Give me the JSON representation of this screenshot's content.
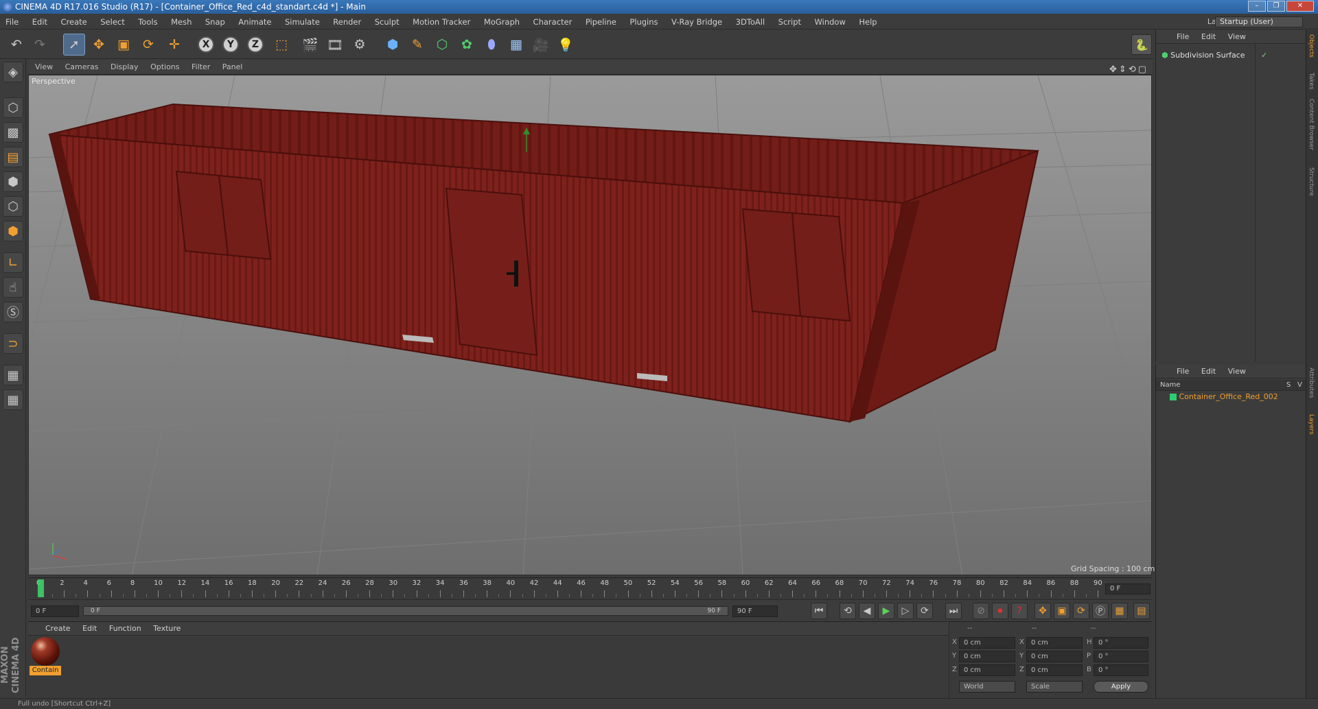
{
  "window": {
    "title": "CINEMA 4D R17.016 Studio (R17) - [Container_Office_Red_c4d_standart.c4d *] - Main",
    "buttons": [
      "–",
      "❐",
      "✕"
    ]
  },
  "menubar": {
    "items": [
      "File",
      "Edit",
      "Create",
      "Select",
      "Tools",
      "Mesh",
      "Snap",
      "Animate",
      "Simulate",
      "Render",
      "Sculpt",
      "Motion Tracker",
      "MoGraph",
      "Character",
      "Pipeline",
      "Plugins",
      "V-Ray Bridge",
      "3DToAll",
      "Script",
      "Window",
      "Help"
    ],
    "layout_label": "Layout:",
    "layout_value": "Startup (User)"
  },
  "toolbar": {
    "icons": [
      "undo-icon",
      "redo-icon",
      "select-arrow-icon",
      "move-icon",
      "scale-icon",
      "rotate-icon",
      "live-select-icon",
      "x-axis-icon",
      "y-axis-icon",
      "z-axis-icon",
      "coordinate-system-icon",
      "render-view-icon",
      "render-picture-viewer-icon",
      "render-settings-icon",
      "cube-icon",
      "pen-icon",
      "subdivision-icon",
      "array-icon",
      "deformer-icon",
      "floor-icon",
      "camera-icon",
      "light-icon"
    ],
    "axis_x": "X",
    "axis_y": "Y",
    "axis_z": "Z"
  },
  "viewport": {
    "menu": [
      "View",
      "Cameras",
      "Display",
      "Options",
      "Filter",
      "Panel"
    ],
    "label": "Perspective",
    "grid_spacing": "Grid Spacing : 100 cm",
    "nav_glyphs": "✥⇕⟲▢"
  },
  "timeline": {
    "ticks": [
      "0",
      "2",
      "4",
      "6",
      "8",
      "10",
      "12",
      "14",
      "16",
      "18",
      "20",
      "22",
      "24",
      "26",
      "28",
      "30",
      "32",
      "34",
      "36",
      "38",
      "40",
      "42",
      "44",
      "46",
      "48",
      "50",
      "52",
      "54",
      "56",
      "58",
      "60",
      "62",
      "64",
      "66",
      "68",
      "70",
      "72",
      "74",
      "76",
      "78",
      "80",
      "82",
      "84",
      "86",
      "88",
      "90"
    ],
    "current_frame": "0 F",
    "end_frame_field": "0 F"
  },
  "transport": {
    "start_field": "0 F",
    "range_start": "0 F",
    "range_end": "90 F",
    "end_field": "90 F"
  },
  "materials": {
    "menu": [
      "Create",
      "Edit",
      "Function",
      "Texture"
    ],
    "items": [
      {
        "label": "Contain"
      }
    ]
  },
  "coordinates": {
    "headers": [
      "--",
      "--",
      "--"
    ],
    "rows": [
      {
        "axis": "X",
        "pos": "0 cm",
        "saxis": "X",
        "size": "0 cm",
        "raxis": "H",
        "rot": "0 °"
      },
      {
        "axis": "Y",
        "pos": "0 cm",
        "saxis": "Y",
        "size": "0 cm",
        "raxis": "P",
        "rot": "0 °"
      },
      {
        "axis": "Z",
        "pos": "0 cm",
        "saxis": "Z",
        "size": "0 cm",
        "raxis": "B",
        "rot": "0 °"
      }
    ],
    "mode1": "World",
    "mode2": "Scale",
    "apply": "Apply"
  },
  "objects_panel": {
    "menu": [
      "File",
      "Edit",
      "View"
    ],
    "items": [
      {
        "name": "Subdivision Surface"
      }
    ]
  },
  "layers_panel": {
    "menu": [
      "File",
      "Edit",
      "View"
    ],
    "header_name": "Name",
    "header_s": "S",
    "header_v": "V",
    "items": [
      {
        "name": "Container_Office_Red_002",
        "color": "#2ecc71"
      }
    ]
  },
  "side_tabs": [
    "Objects",
    "Takes",
    "Content Browser",
    "Structure",
    "Attributes",
    "Layers"
  ],
  "status": "Full undo [Shortcut Ctrl+Z]",
  "brand": "MAXON CINEMA 4D",
  "colors": {
    "accent": "#f0a030",
    "container": "#7a1f1a",
    "grid_bg": "#8a8a8a"
  }
}
